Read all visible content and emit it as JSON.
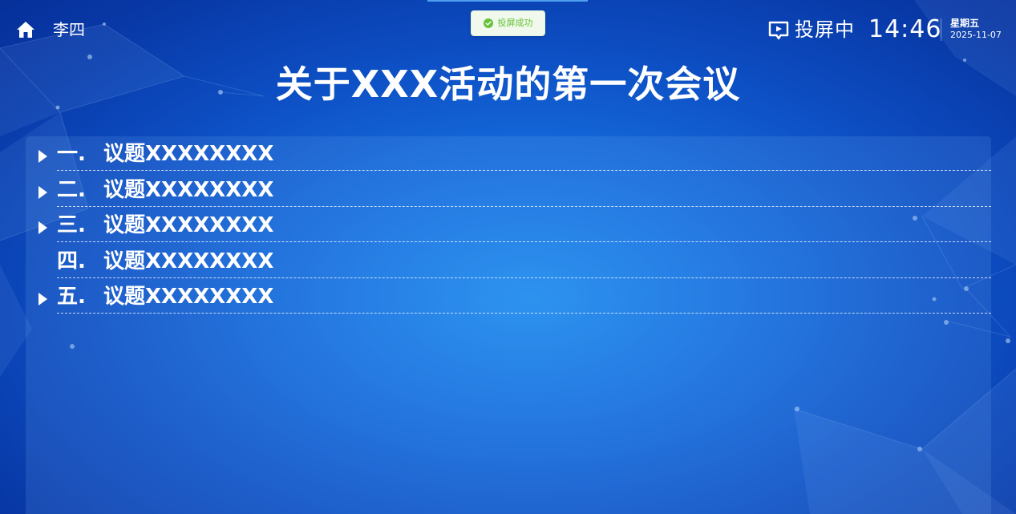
{
  "header": {
    "user_name": "李四",
    "cast_status": "投屏中",
    "time": "14:46",
    "weekday": "星期五",
    "date": "2025-11-07"
  },
  "toast": {
    "text": "投屏成功",
    "color": "#67c23a"
  },
  "meeting": {
    "title": "关于XXX活动的第一次会议"
  },
  "agenda": {
    "items": [
      {
        "number": "一.",
        "title": "议题XXXXXXXX",
        "expandable": true
      },
      {
        "number": "二.",
        "title": "议题XXXXXXXX",
        "expandable": true
      },
      {
        "number": "三.",
        "title": "议题XXXXXXXX",
        "expandable": true
      },
      {
        "number": "四.",
        "title": "议题XXXXXXXX",
        "expandable": false
      },
      {
        "number": "五.",
        "title": "议题XXXXXXXX",
        "expandable": true
      }
    ]
  },
  "icons": {
    "home": "home-icon",
    "cast": "screen-cast-icon",
    "toast": "check-circle-icon",
    "expand": "caret-right-icon"
  },
  "colors": {
    "background_center": "#1e8ef0",
    "background_edge": "#06309a",
    "toast_background": "#f0f9eb",
    "text": "#ffffff"
  }
}
